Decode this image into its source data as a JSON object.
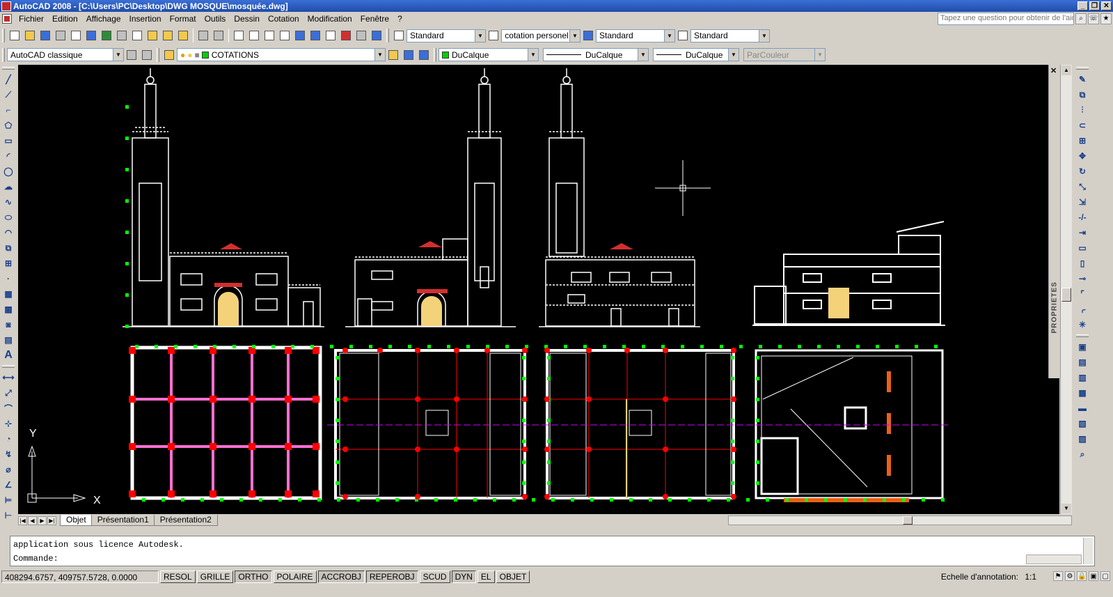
{
  "window": {
    "title": "AutoCAD 2008 - [C:\\Users\\PC\\Desktop\\DWG MOSQUE\\mosquée.dwg]"
  },
  "menu": [
    "Fichier",
    "Edition",
    "Affichage",
    "Insertion",
    "Format",
    "Outils",
    "Dessin",
    "Cotation",
    "Modification",
    "Fenêtre",
    "?"
  ],
  "help": {
    "placeholder": "Tapez une question pour obtenir de l'aide"
  },
  "toolbar": {
    "text_style": "Standard",
    "dim_style": "cotation personel",
    "table_style": "Standard",
    "multileader_style": "Standard",
    "workspace": "AutoCAD classique",
    "layer": "COTATIONS",
    "color": "DuCalque",
    "linetype": "DuCalque",
    "lineweight": "DuCalque",
    "plotstyle": "ParCouleur"
  },
  "palette": {
    "title": "PROPRIETES"
  },
  "drawing": {
    "ucs_y": "Y",
    "ucs_x": "X"
  },
  "tabs": [
    "Objet",
    "Présentation1",
    "Présentation2"
  ],
  "command": {
    "history": "application sous licence Autodesk.",
    "prompt": "Commande:"
  },
  "status": {
    "coords": "408294.6757, 409757.5728, 0.0000",
    "buttons": [
      "RESOL",
      "GRILLE",
      "ORTHO",
      "POLAIRE",
      "ACCROBJ",
      "REPEROBJ",
      "SCUD",
      "DYN",
      "EL",
      "OBJET"
    ],
    "annotation_label": "Echelle d'annotation:",
    "annotation_scale": "1:1"
  },
  "colors": {
    "title_bar": "#1f4ca8",
    "canvas": "#000000",
    "drawing_lines": "#ffffff",
    "columns": "#ff0000",
    "grid_lines": "#ff0000",
    "dimension_marks": "#00ff00",
    "axis_line": "#cc00ff",
    "roofs": "#d32f2f",
    "doors": "#f3d27a"
  }
}
